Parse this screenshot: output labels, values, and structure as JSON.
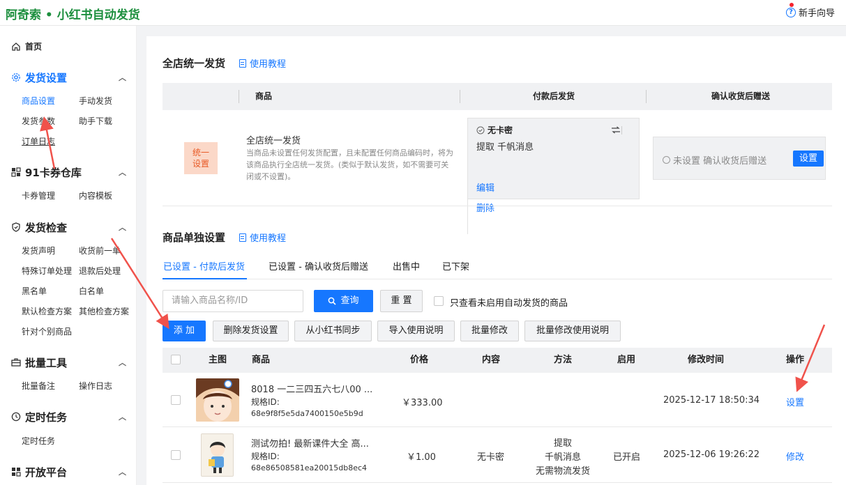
{
  "app": {
    "title": "阿奇索 • 小红书自动发货",
    "guide_label": "新手向导"
  },
  "sidebar": {
    "home": "首页",
    "sections": [
      {
        "title": "发货设置",
        "items": [
          "商品设置",
          "手动发货",
          "发货参数",
          "助手下载",
          "订单日志"
        ]
      },
      {
        "title": "91卡券仓库",
        "items": [
          "卡券管理",
          "内容模板"
        ]
      },
      {
        "title": "发货检查",
        "items": [
          "发货声明",
          "收货前一单",
          "特殊订单处理",
          "退款后处理",
          "黑名单",
          "白名单",
          "默认检查方案",
          "其他检查方案",
          "针对个别商品"
        ]
      },
      {
        "title": "批量工具",
        "items": [
          "批量备注",
          "操作日志"
        ]
      },
      {
        "title": "定时任务",
        "items": [
          "定时任务"
        ]
      },
      {
        "title": "开放平台",
        "items": []
      }
    ]
  },
  "unified": {
    "title": "全店统一发货",
    "tutorial": "使用教程",
    "headers": [
      "商品",
      "付款后发货",
      "确认收货后赠送"
    ],
    "tag": "统一\n设置",
    "name": "全店统一发货",
    "desc": "当商品未设置任何发货配置，且未配置任何商品编码时，将为该商品执行全店统一发货。(类似于默认发货，如不需要可关闭或不设置)。",
    "card_title": "无卡密",
    "card_content": "提取 千帆消息",
    "edit": "编辑",
    "delete": "删除",
    "gift_status": "未设置 确认收货后赠送",
    "set_button": "设置"
  },
  "individual": {
    "title": "商品单独设置",
    "tutorial": "使用教程",
    "tabs": [
      "已设置 - 付款后发货",
      "已设置 - 确认收货后赠送",
      "出售中",
      "已下架"
    ],
    "search_placeholder": "请输入商品名称/ID",
    "query_button": "查询",
    "reset_button": "重 置",
    "only_disabled_label": "只查看未启用自动发货的商品",
    "actions": [
      "添 加",
      "删除发货设置",
      "从小红书同步",
      "导入使用说明",
      "批量修改",
      "批量修改使用说明"
    ],
    "columns": [
      "主图",
      "商品",
      "价格",
      "内容",
      "方法",
      "启用",
      "修改时间",
      "操作"
    ],
    "rows": [
      {
        "name": "8018 一二三四五六七八00 ...",
        "spec_label": "规格ID:",
        "spec_id": "68e9f8f5e5da7400150e5b9d",
        "price": "￥333.00",
        "content": "",
        "method": [
          "",
          "",
          ""
        ],
        "enabled": "",
        "time": "2025-12-17 18:50:34",
        "action": "设置"
      },
      {
        "name": "测试勿拍! 最新课件大全 高...",
        "spec_label": "规格ID:",
        "spec_id": "68e86508581ea20015db8ec4",
        "price": "￥1.00",
        "content": "无卡密",
        "method": [
          "提取",
          "千帆消息",
          "无需物流发货"
        ],
        "enabled": "已开启",
        "time": "2025-12-06 19:26:22",
        "action": "修改"
      }
    ]
  },
  "colors": {
    "brand": "#1d8f3e",
    "primary": "#1677ff",
    "arrow": "#f0524b",
    "tag_bg": "#fbd8c8",
    "tag_text": "#e85a26"
  }
}
